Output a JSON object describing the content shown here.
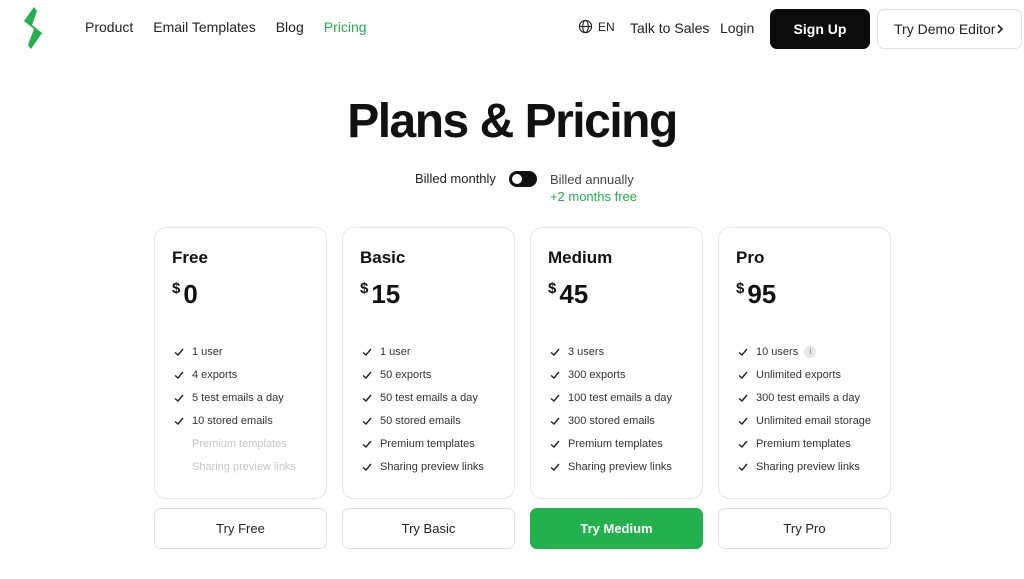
{
  "nav": {
    "items": [
      {
        "label": "Product",
        "active": false
      },
      {
        "label": "Email Templates",
        "active": false
      },
      {
        "label": "Blog",
        "active": false
      },
      {
        "label": "Pricing",
        "active": true
      }
    ],
    "language": "EN",
    "talk_to_sales": "Talk to Sales",
    "login": "Login",
    "signup": "Sign Up",
    "demo": "Try Demo Editor"
  },
  "hero": {
    "title": "Plans & Pricing",
    "billed_monthly": "Billed monthly",
    "billed_annually": "Billed annually",
    "annual_bonus": "+2 months free"
  },
  "plans": [
    {
      "name": "Free",
      "currency": "$",
      "price": "0",
      "button": "Try Free",
      "features": [
        "1 user",
        "4 exports",
        "5 test emails a day",
        "10 stored emails"
      ],
      "disabled_features": [
        "Premium templates",
        "Sharing preview links"
      ]
    },
    {
      "name": "Basic",
      "currency": "$",
      "price": "15",
      "button": "Try Basic",
      "features": [
        "1 user",
        "50 exports",
        "50 test emails a day",
        "50 stored emails",
        "Premium templates",
        "Sharing preview links"
      ],
      "disabled_features": []
    },
    {
      "name": "Medium",
      "currency": "$",
      "price": "45",
      "button": "Try Medium",
      "features": [
        "3 users",
        "300 exports",
        "100 test emails a day",
        "300 stored emails",
        "Premium templates",
        "Sharing preview links"
      ],
      "disabled_features": []
    },
    {
      "name": "Pro",
      "currency": "$",
      "price": "95",
      "button": "Try Pro",
      "features": [
        "10 users",
        "Unlimited exports",
        "300 test emails a day",
        "Unlimited email storage",
        "Premium templates",
        "Sharing preview links"
      ],
      "disabled_features": []
    }
  ],
  "colors": {
    "accent": "#22b14c",
    "dark": "#0b0b0b"
  }
}
